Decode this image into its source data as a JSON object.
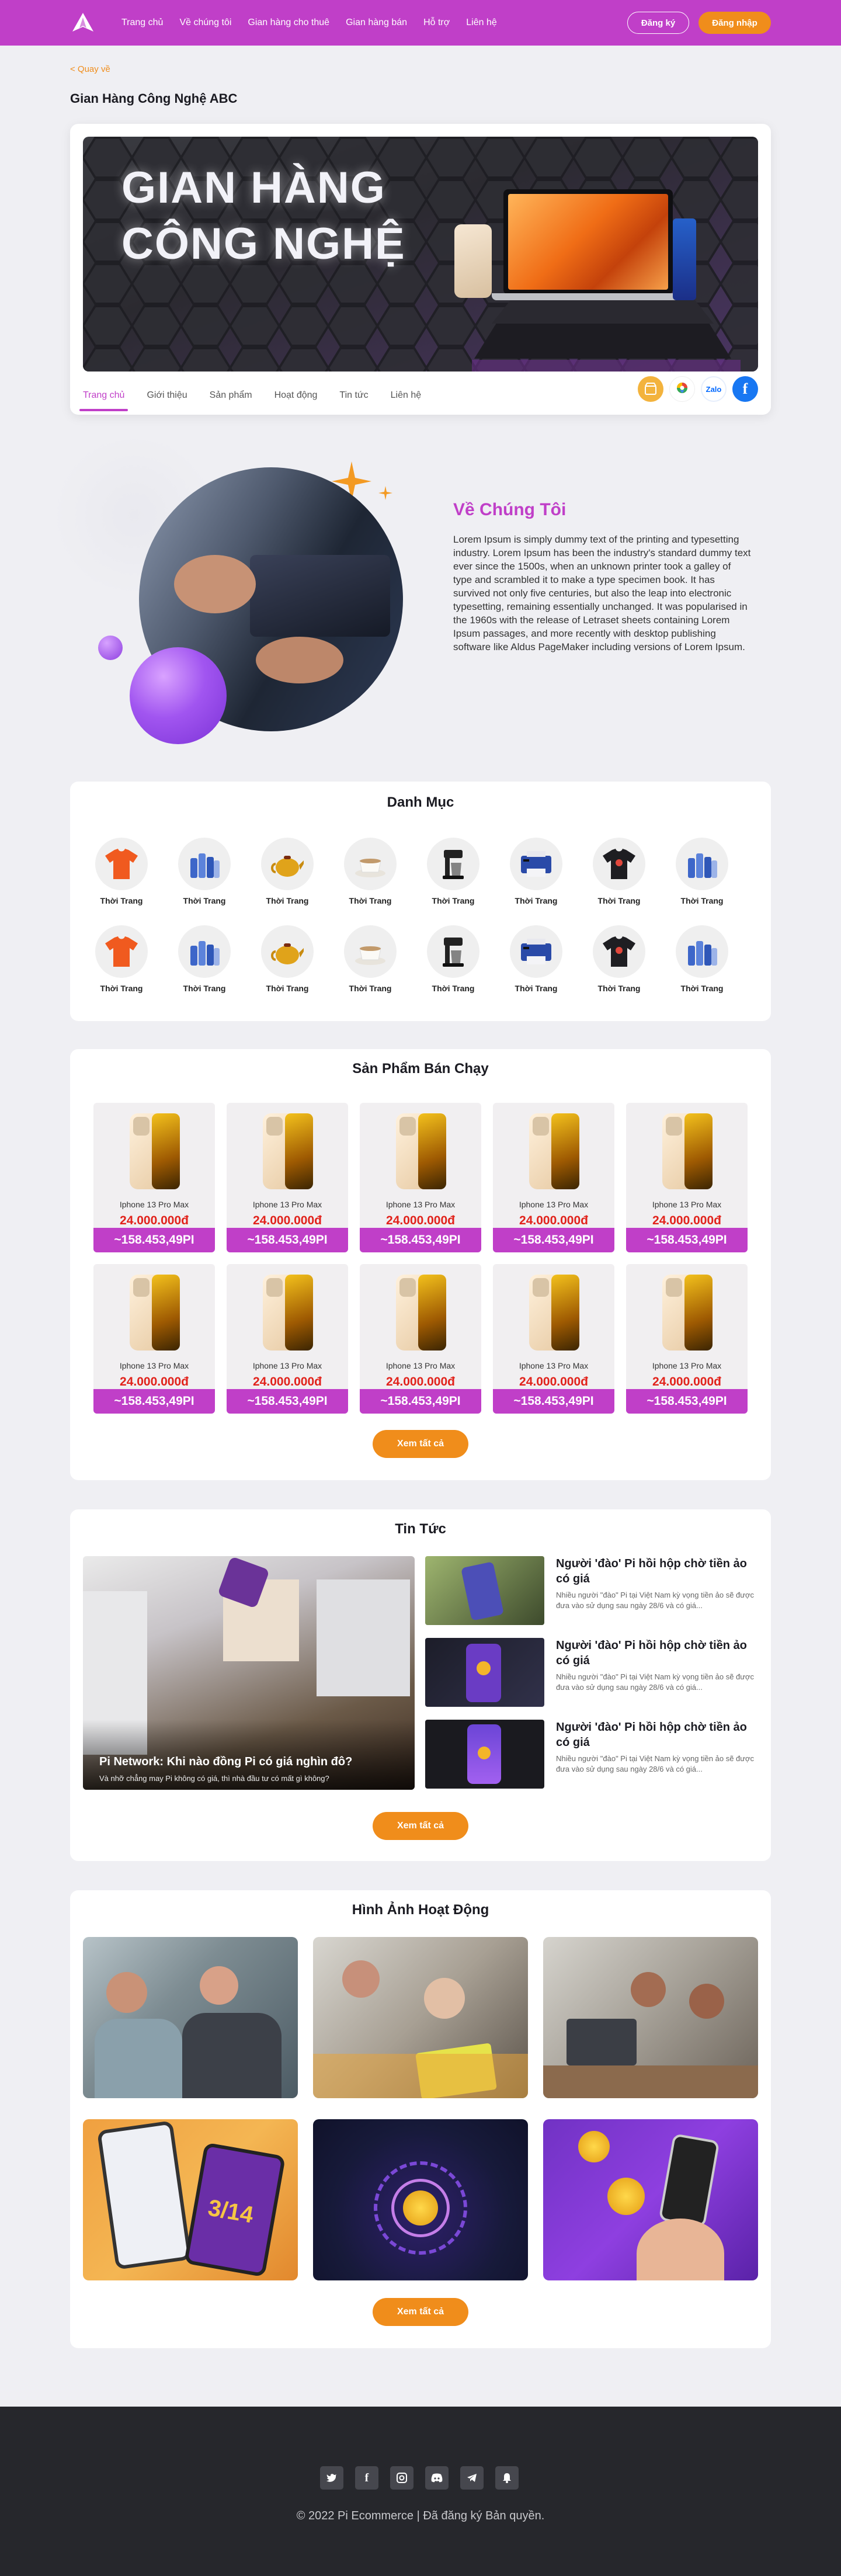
{
  "header": {
    "nav": [
      "Trang chủ",
      "Về chúng tôi",
      "Gian hàng cho thuê",
      "Gian hàng bán",
      "Hỗ trợ",
      "Liên hệ"
    ],
    "register": "Đăng ký",
    "login": "Đăng nhập",
    "brand_color": "#c03fc8",
    "accent_color": "#f08d1b"
  },
  "back_link": "< Quay về",
  "shop_title": "Gian Hàng Công Nghệ ABC",
  "banner_text_line1": "GIAN HÀNG",
  "banner_text_line2": "CÔNG NGHỆ",
  "shop_tabs": [
    "Trang chủ",
    "Giới thiệu",
    "Sản phẩm",
    "Hoạt động",
    "Tin tức",
    "Liên hệ"
  ],
  "shop_social": {
    "zalo": "Zalo"
  },
  "about": {
    "title": "Về Chúng Tôi",
    "text": "Lorem Ipsum is simply dummy text of the printing and typesetting industry. Lorem Ipsum has been the industry's standard dummy text ever since the 1500s, when an unknown printer took a galley of type and scrambled it to make a type specimen book. It has survived not only five centuries, but also the leap into electronic typesetting, remaining essentially unchanged. It was popularised in the 1960s with the release of Letraset sheets containing Lorem Ipsum passages, and more recently with desktop publishing software like Aldus PageMaker including versions of Lorem Ipsum."
  },
  "categories": {
    "title": "Danh Mục",
    "items": [
      {
        "label": "Thời Trang",
        "icon": "orange-tshirt"
      },
      {
        "label": "Thời Trang",
        "icon": "water-bottles"
      },
      {
        "label": "Thời Trang",
        "icon": "teapot"
      },
      {
        "label": "Thời Trang",
        "icon": "coffee-cup"
      },
      {
        "label": "Thời Trang",
        "icon": "coffee-maker"
      },
      {
        "label": "Thời Trang",
        "icon": "printer"
      },
      {
        "label": "Thời Trang",
        "icon": "black-tshirt"
      },
      {
        "label": "Thời Trang",
        "icon": "water-bottles"
      },
      {
        "label": "Thời Trang",
        "icon": "orange-tshirt"
      },
      {
        "label": "Thời Trang",
        "icon": "water-bottles"
      },
      {
        "label": "Thời Trang",
        "icon": "teapot"
      },
      {
        "label": "Thời Trang",
        "icon": "coffee-cup"
      },
      {
        "label": "Thời Trang",
        "icon": "coffee-maker"
      },
      {
        "label": "Thời Trang",
        "icon": "printer"
      },
      {
        "label": "Thời Trang",
        "icon": "black-tshirt"
      },
      {
        "label": "Thời Trang",
        "icon": "water-bottles"
      }
    ]
  },
  "bestsellers": {
    "title": "Sản Phẩm Bán Chạy",
    "products": [
      {
        "name": "Iphone 13 Pro Max",
        "price": "24.000.000đ",
        "pi": "~158.453,49PI"
      },
      {
        "name": "Iphone 13 Pro Max",
        "price": "24.000.000đ",
        "pi": "~158.453,49PI"
      },
      {
        "name": "Iphone 13 Pro Max",
        "price": "24.000.000đ",
        "pi": "~158.453,49PI"
      },
      {
        "name": "Iphone 13 Pro Max",
        "price": "24.000.000đ",
        "pi": "~158.453,49PI"
      },
      {
        "name": "Iphone 13 Pro Max",
        "price": "24.000.000đ",
        "pi": "~158.453,49PI"
      },
      {
        "name": "Iphone 13 Pro Max",
        "price": "24.000.000đ",
        "pi": "~158.453,49PI"
      },
      {
        "name": "Iphone 13 Pro Max",
        "price": "24.000.000đ",
        "pi": "~158.453,49PI"
      },
      {
        "name": "Iphone 13 Pro Max",
        "price": "24.000.000đ",
        "pi": "~158.453,49PI"
      },
      {
        "name": "Iphone 13 Pro Max",
        "price": "24.000.000đ",
        "pi": "~158.453,49PI"
      },
      {
        "name": "Iphone 13 Pro Max",
        "price": "24.000.000đ",
        "pi": "~158.453,49PI"
      }
    ],
    "more": "Xem tất cả"
  },
  "news": {
    "title": "Tin Tức",
    "featured_title": "Pi Network: Khi nào đồng Pi có giá nghìn đô?",
    "featured_sub": "Và nhỡ chẳng may Pi không có giá, thì nhà đầu tư có mất gì không?",
    "items": [
      {
        "title": "Người 'đào' Pi hồi hộp chờ tiền ảo có giá",
        "desc": "Nhiều người \"đào\" Pi tại Việt Nam kỳ vọng tiền ảo sẽ được đưa vào sử dụng sau ngày 28/6 và có giá..."
      },
      {
        "title": "Người 'đào' Pi hồi hộp chờ tiền ảo có giá",
        "desc": "Nhiều người \"đào\" Pi tại Việt Nam kỳ vọng tiền ảo sẽ được đưa vào sử dụng sau ngày 28/6 và có giá..."
      },
      {
        "title": "Người 'đào' Pi hồi hộp chờ tiền ảo có giá",
        "desc": "Nhiều người \"đào\" Pi tại Việt Nam kỳ vọng tiền ảo sẽ được đưa vào sử dụng sau ngày 28/6 và có giá..."
      }
    ],
    "more": "Xem tất cả"
  },
  "gallery": {
    "title": "Hình Ảnh Hoạt Động",
    "phone_text": "3/14",
    "more": "Xem tất cả"
  },
  "footer": {
    "social": [
      "twitter-icon",
      "facebook-icon",
      "instagram-icon",
      "discord-icon",
      "telegram-icon",
      "notification-icon"
    ],
    "copyright": "© 2022 Pi Ecommerce | Đã đăng ký Bản quyền."
  }
}
